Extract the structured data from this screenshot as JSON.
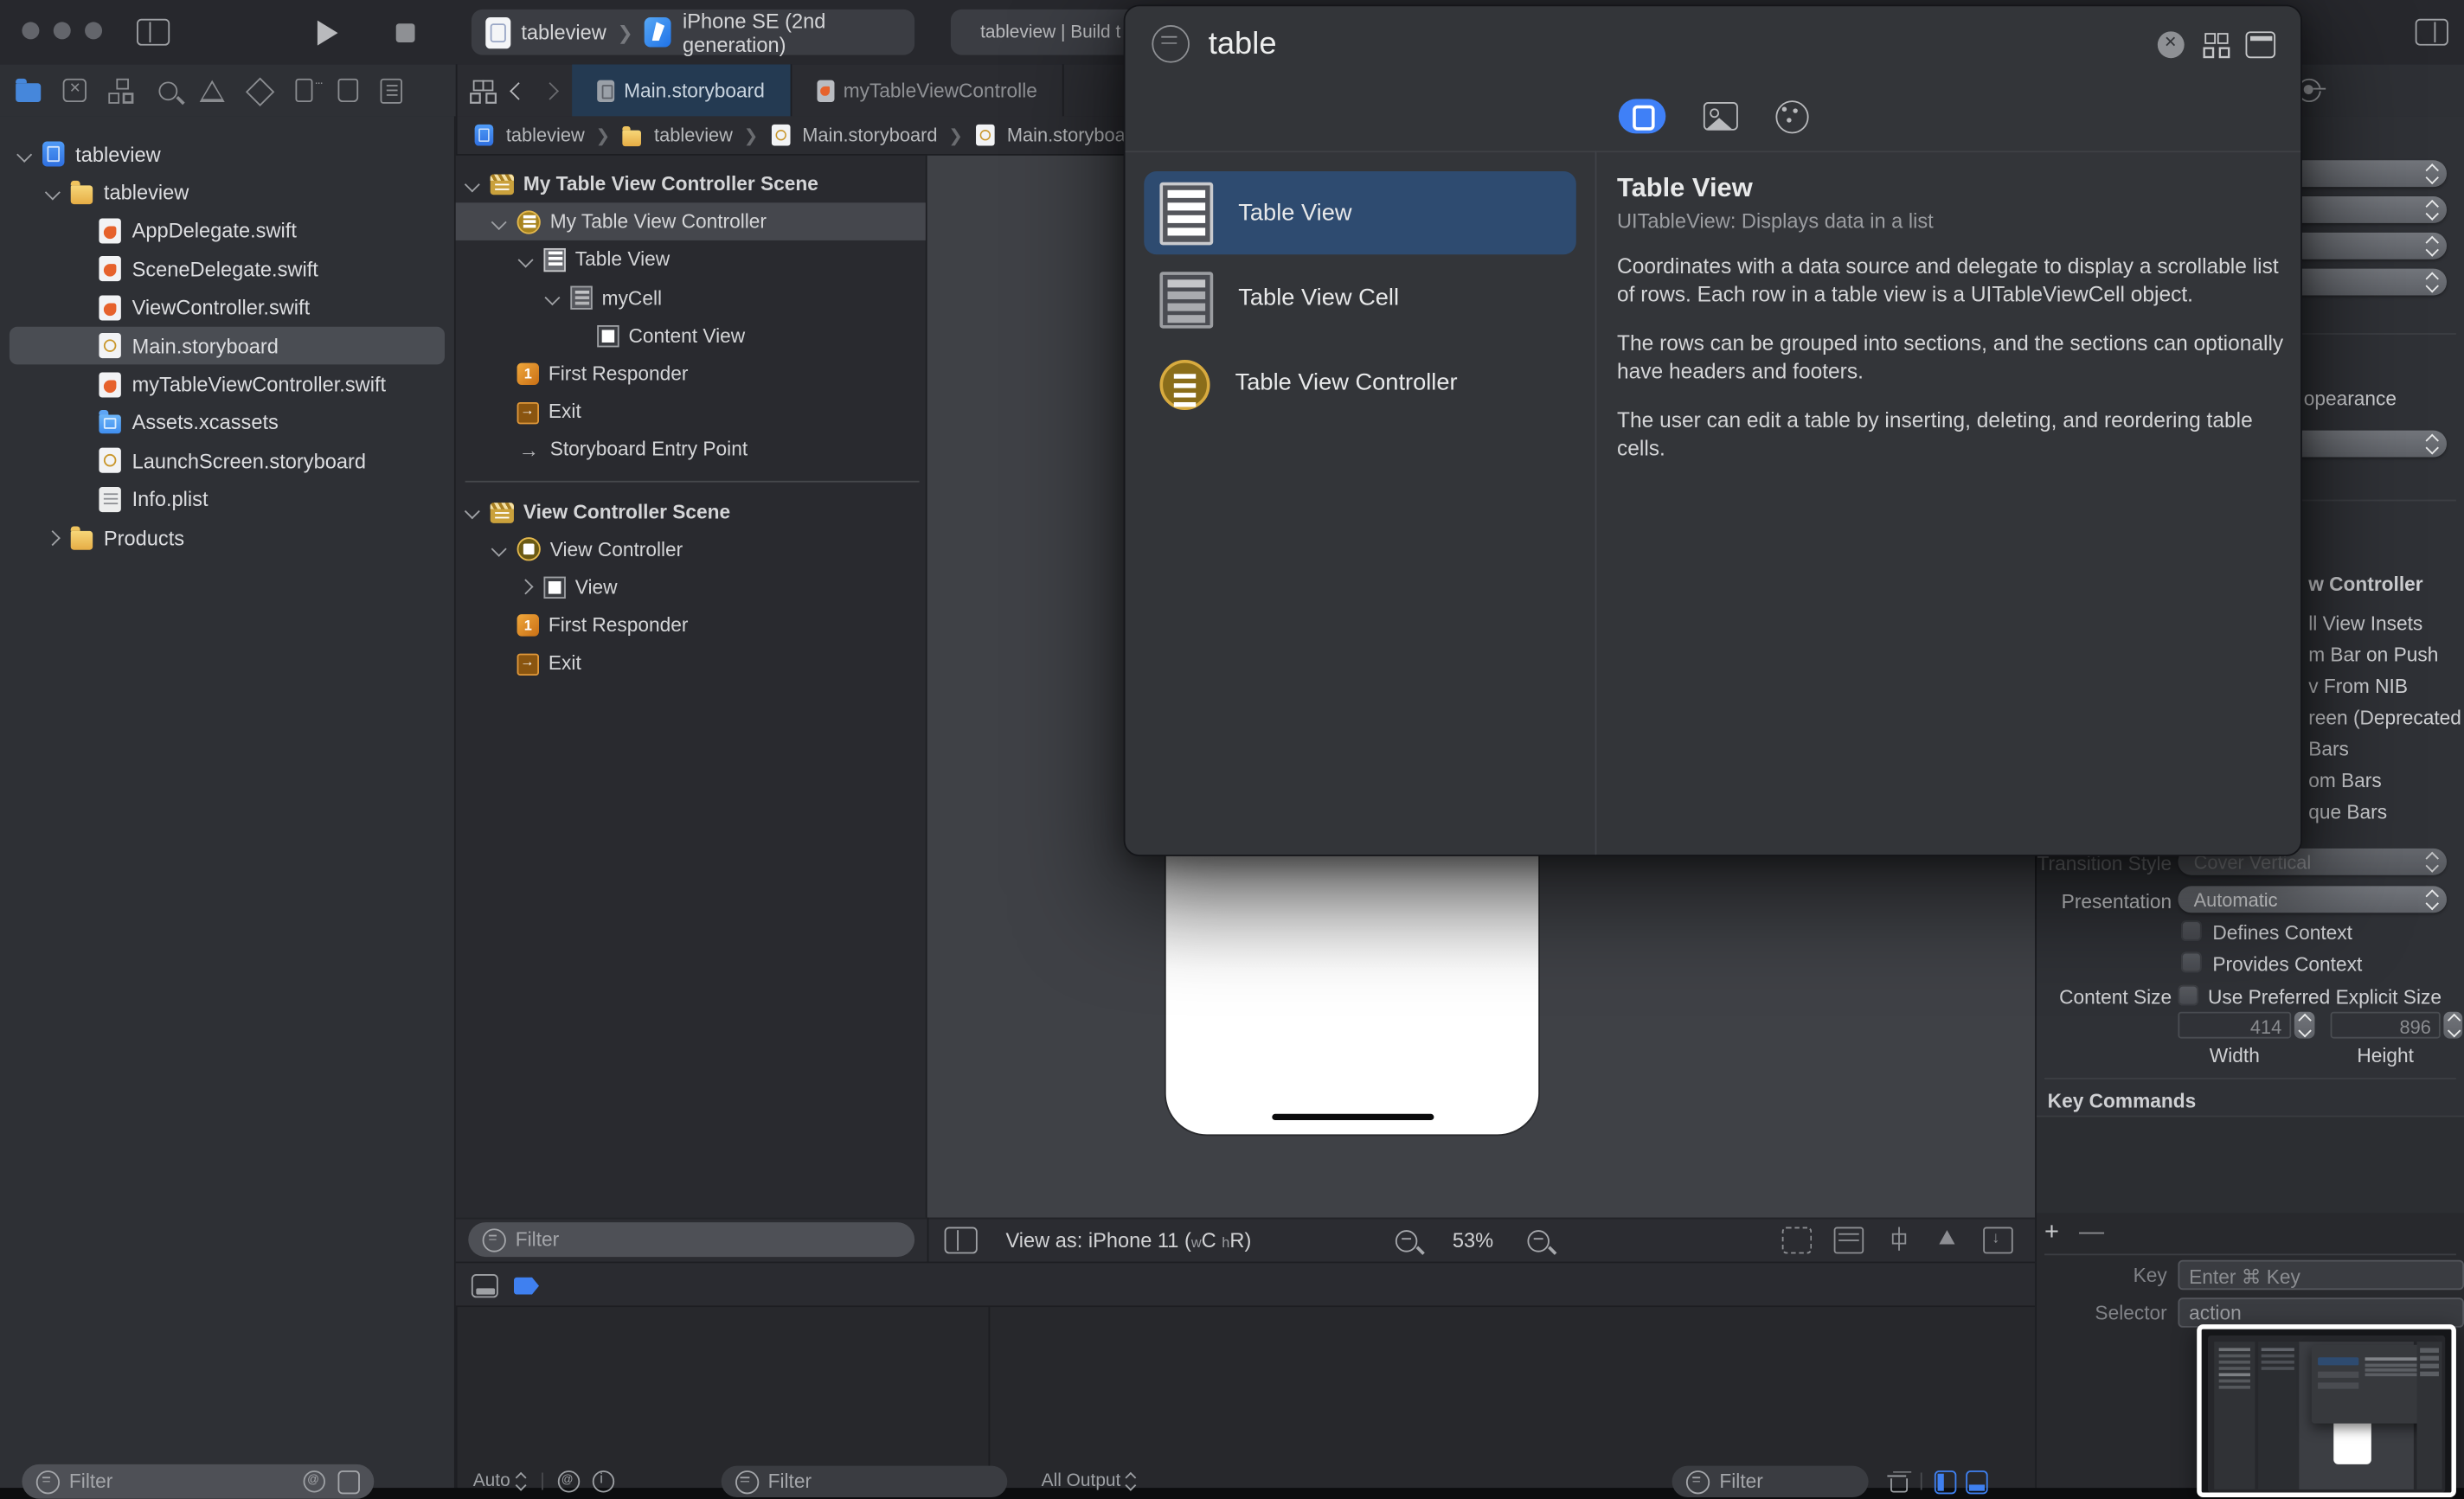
{
  "window": {
    "traffic_lights": [
      "close",
      "minimize",
      "zoom"
    ]
  },
  "toolbar": {
    "scheme_project": "tableview",
    "scheme_device": "iPhone SE (2nd generation)",
    "status_text": "tableview | Build t"
  },
  "navigator_tabs": [
    "project",
    "source-control",
    "symbol",
    "find",
    "issue",
    "test",
    "debug",
    "breakpoint",
    "report"
  ],
  "navigator": {
    "files": [
      {
        "name": "tableview",
        "icon": "proj",
        "level": 0,
        "chevron": "d"
      },
      {
        "name": "tableview",
        "icon": "folder",
        "level": 1,
        "chevron": "d"
      },
      {
        "name": "AppDelegate.swift",
        "icon": "swift",
        "level": 2,
        "chevron": "none"
      },
      {
        "name": "SceneDelegate.swift",
        "icon": "swift",
        "level": 2,
        "chevron": "none"
      },
      {
        "name": "ViewController.swift",
        "icon": "swift",
        "level": 2,
        "chevron": "none"
      },
      {
        "name": "Main.storyboard",
        "icon": "storyboard",
        "level": 2,
        "chevron": "none",
        "selected": true
      },
      {
        "name": "myTableViewController.swift",
        "icon": "swift",
        "level": 2,
        "chevron": "none"
      },
      {
        "name": "Assets.xcassets",
        "icon": "folder-blue",
        "level": 2,
        "chevron": "none"
      },
      {
        "name": "LaunchScreen.storyboard",
        "icon": "storyboard",
        "level": 2,
        "chevron": "none"
      },
      {
        "name": "Info.plist",
        "icon": "plist",
        "level": 2,
        "chevron": "none"
      },
      {
        "name": "Products",
        "icon": "folder",
        "level": 1,
        "chevron": "r"
      }
    ],
    "filter_placeholder": "Filter"
  },
  "editor": {
    "tabs": [
      {
        "label": "Main.storyboard",
        "icon": "storyboard",
        "active": true
      },
      {
        "label": "myTableViewControlle",
        "icon": "swift",
        "active": false
      }
    ],
    "breadcrumb": [
      {
        "label": "tableview",
        "icon": "proj"
      },
      {
        "label": "tableview",
        "icon": "folder"
      },
      {
        "label": "Main.storyboard",
        "icon": "storyboard"
      },
      {
        "label": "Main.storyboa",
        "icon": "storyboard"
      }
    ]
  },
  "outline": {
    "scenes": [
      {
        "title": "My Table View Controller Scene",
        "rows": [
          {
            "label": "My Table View Controller",
            "icon": "circle-table",
            "chevron": "d",
            "indent": 1,
            "selected": true
          },
          {
            "label": "Table View",
            "icon": "table",
            "chevron": "d",
            "indent": 2
          },
          {
            "label": "myCell",
            "icon": "cell",
            "chevron": "d",
            "indent": 3
          },
          {
            "label": "Content View",
            "icon": "sq",
            "chevron": "none",
            "indent": 4
          },
          {
            "label": "First Responder",
            "icon": "cube",
            "chevron": "none",
            "indent": 1
          },
          {
            "label": "Exit",
            "icon": "exit",
            "chevron": "none",
            "indent": 1
          },
          {
            "label": "Storyboard Entry Point",
            "icon": "arrow",
            "chevron": "none",
            "indent": 1
          }
        ]
      },
      {
        "title": "View Controller Scene",
        "rows": [
          {
            "label": "View Controller",
            "icon": "circle-sq",
            "chevron": "d",
            "indent": 1
          },
          {
            "label": "View",
            "icon": "sq",
            "chevron": "r",
            "indent": 2
          },
          {
            "label": "First Responder",
            "icon": "cube",
            "chevron": "none",
            "indent": 1
          },
          {
            "label": "Exit",
            "icon": "exit",
            "chevron": "none",
            "indent": 1
          }
        ]
      }
    ],
    "filter_placeholder": "Filter"
  },
  "canvas": {
    "view_as_prefix": "View as: iPhone 11 (",
    "w_small": "w",
    "w_cap": "C",
    "h_small": "h",
    "h_cap": "R",
    "view_as_suffix": ")",
    "zoom_level": "53%",
    "right_icons": [
      "update-frames",
      "align",
      "add-constraints",
      "resolve-auto-layout",
      "embed-in"
    ]
  },
  "library": {
    "search_value": "table",
    "segments": [
      "objects",
      "media",
      "colors"
    ],
    "items": [
      {
        "label": "Table View",
        "icon": "table-view",
        "selected": true
      },
      {
        "label": "Table View Cell",
        "icon": "table-view-cell",
        "selected": false
      },
      {
        "label": "Table View Controller",
        "icon": "table-view-controller",
        "selected": false
      }
    ],
    "detail": {
      "title": "Table View",
      "subtitle": "UITableView: Displays data in a list",
      "paragraphs": [
        "Coordinates with a data source and delegate to display a scrollable list of rows. Each row in a table view is a UITableViewCell object.",
        "The rows can be grouped into sections, and the sections can optionally have headers and footers.",
        "The user can edit a table by inserting, deleting, and reordering table cells."
      ]
    }
  },
  "inspector": {
    "appearance_fragment": "opearance",
    "header_fragment": "w Controller",
    "checkbox_fragments": [
      "ll View Insets",
      "m Bar on Push",
      "v From NIB",
      "reen (Deprecated",
      "Bars",
      "om Bars",
      "que Bars"
    ],
    "transition_style_label": "Transition Style",
    "transition_style_value": "Cover Vertical",
    "presentation_label": "Presentation",
    "presentation_value": "Automatic",
    "checkbox_defines": "Defines Context",
    "checkbox_provides": "Provides Context",
    "content_size_label": "Content Size",
    "content_size_checkbox": "Use Preferred Explicit Size",
    "width_value": "414",
    "height_value": "896",
    "width_label": "Width",
    "height_label": "Height",
    "key_commands_title": "Key Commands",
    "key_label": "Key",
    "key_placeholder": "Enter ⌘ Key",
    "selector_label": "Selector",
    "selector_value": "action"
  },
  "debug": {
    "auto_label": "Auto",
    "all_output_label": "All Output",
    "filter_placeholder": "Filter"
  },
  "colors": {
    "accent_blue": "#3f80f7",
    "selected_row_blue": "#2e4b70",
    "active_tab_blue": "#243a52",
    "folder_yellow": "#e6ad45",
    "swift_orange": "#e6622c",
    "scene_yellow": "#d8ab3f",
    "canvas_gray": "#3f4146",
    "panel_dark": "#2f3136"
  }
}
